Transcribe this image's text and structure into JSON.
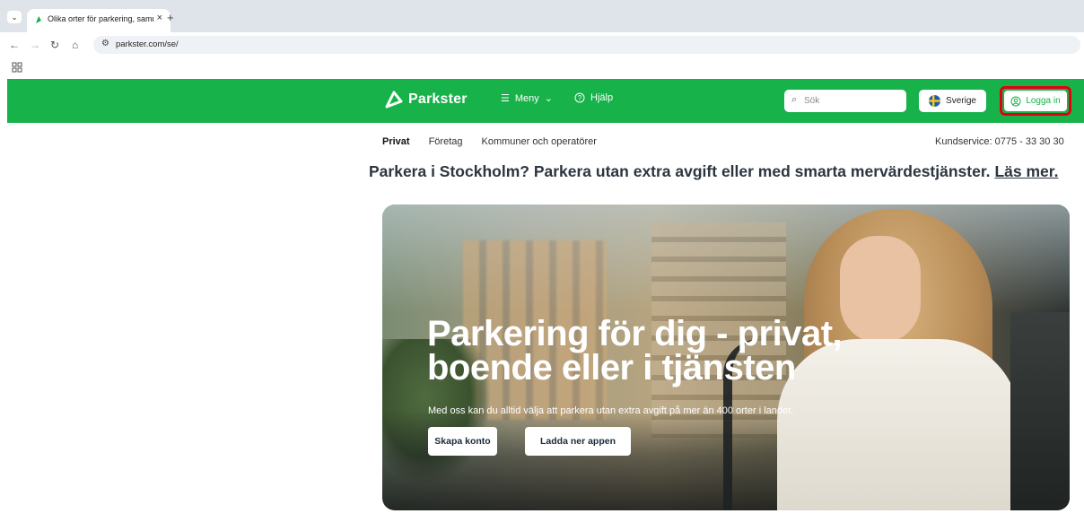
{
  "browser": {
    "tab_title": "Olika orter för parkering, samm",
    "url": "parkster.com/se/"
  },
  "header": {
    "brand": "Parkster",
    "menu_label": "Meny",
    "help_label": "Hjälp",
    "search_placeholder": "Sök",
    "country_label": "Sverige",
    "login_label": "Logga in",
    "brand_color": "#17b24a",
    "highlight_color": "#e3000f"
  },
  "subnav": {
    "items": [
      "Privat",
      "Företag",
      "Kommuner och operatörer"
    ],
    "active": "Privat",
    "kundservice": "Kundservice: 0775 - 33 30 30"
  },
  "promo": {
    "text": "Parkera i Stockholm? Parkera utan extra avgift eller med smarta mervärdestjänster.",
    "link": "Läs mer."
  },
  "hero": {
    "heading_line1": "Parkering för dig - privat,",
    "heading_line2": "boende eller i tjänsten",
    "subtext": "Med oss kan du alltid välja att parkera utan extra avgift på mer än 400 orter i landet.",
    "cta_primary": "Skapa konto",
    "cta_secondary": "Ladda ner appen"
  }
}
